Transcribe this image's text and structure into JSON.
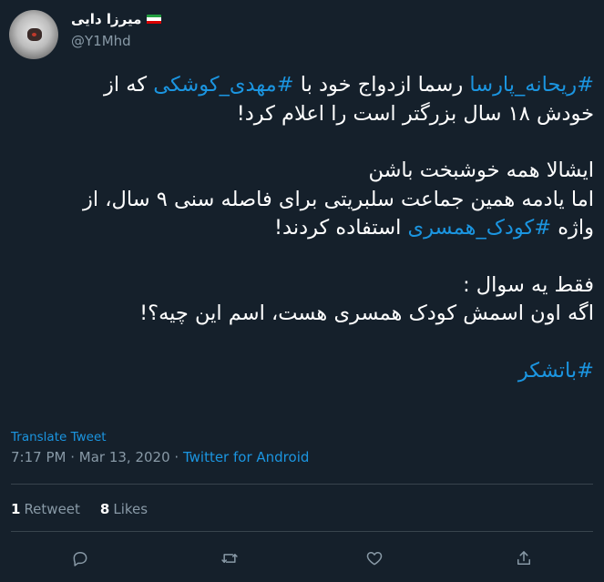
{
  "author": {
    "display_name": "میرزا دایی",
    "handle": "@Y1Mhd",
    "flag_icon": "iran-flag-icon",
    "flag_colors": [
      "#239f40",
      "#ffffff",
      "#da0000"
    ]
  },
  "tweet": {
    "line1": {
      "tag1": "#ریحانه_پارسا",
      "mid": " رسما ازدواج خود با ",
      "tag2": "#مهدی_کوشکی",
      "end": " که از"
    },
    "line2": "خودش ۱۸ سال بزرگتر است را اعلام کرد!",
    "line3": "ایشالا همه خوشبخت باشن",
    "line4": "اما یادمه همین جماعت سلبریتی برای فاصله سنی ۹ سال، از",
    "line5": {
      "start": "واژه ",
      "tag": "#کودک_همسری",
      "end": " استفاده کردند!"
    },
    "line6": "فقط یه سوال :",
    "line7": "اگه اون اسمش کودک همسری هست، اسم این چیه؟!",
    "line8_tag": "#باتشکر"
  },
  "translate_label": "Translate Tweet",
  "meta": {
    "time": "7:17 PM",
    "separator": " · ",
    "date": "Mar 13, 2020",
    "source": "Twitter for Android"
  },
  "stats": {
    "retweets_count": "1",
    "retweets_label": "Retweet",
    "likes_count": "8",
    "likes_label": "Likes"
  },
  "actions": {
    "reply_icon": "reply-icon",
    "retweet_icon": "retweet-icon",
    "like_icon": "heart-icon",
    "share_icon": "share-icon"
  },
  "colors": {
    "background": "#15202b",
    "link": "#1b95e0",
    "muted": "#8899a6",
    "divider": "#38444d"
  }
}
